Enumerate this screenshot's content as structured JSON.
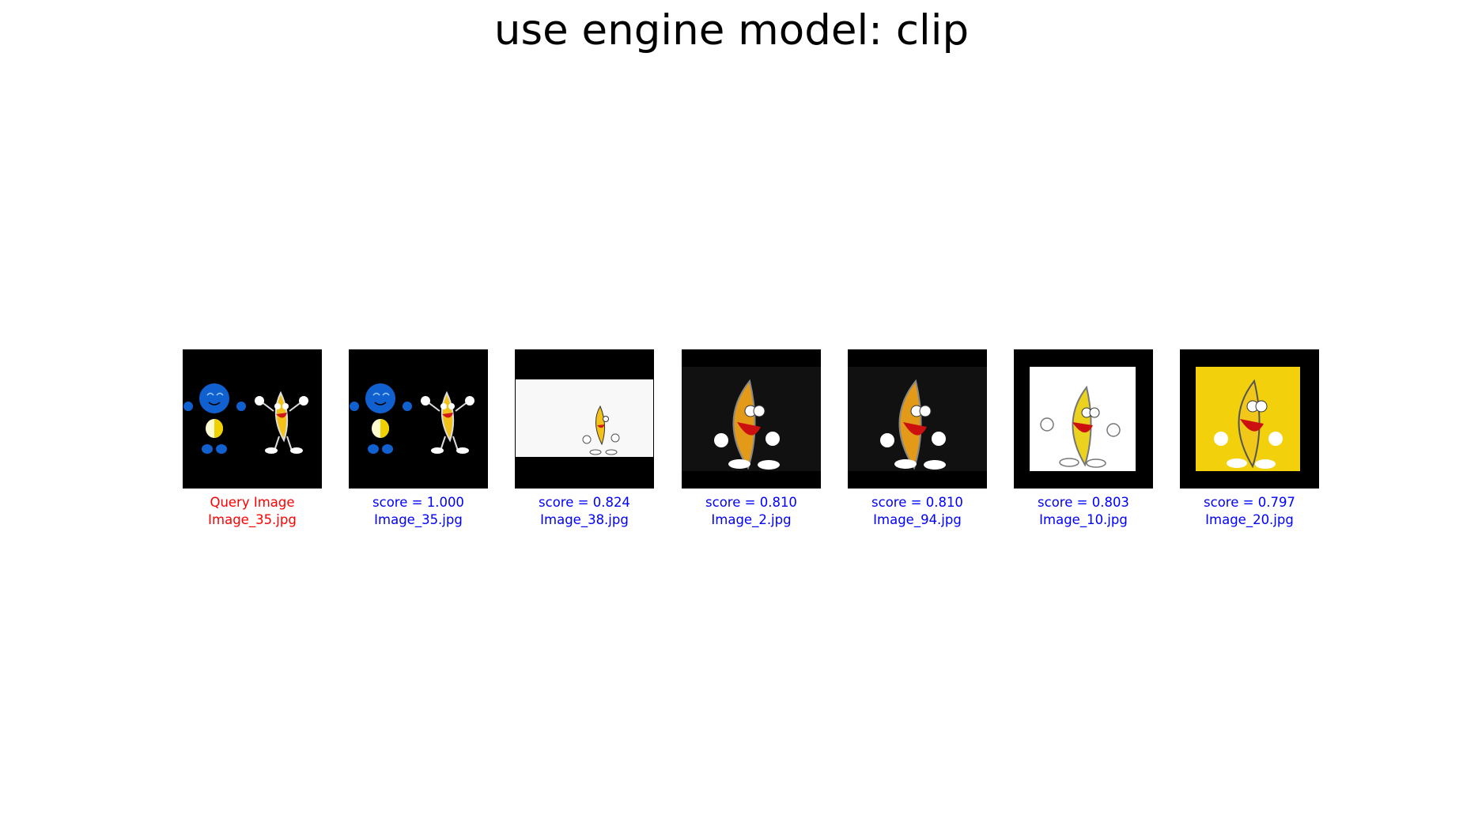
{
  "title": "use engine model: clip",
  "colors": {
    "query_caption": "#ff0000",
    "result_caption": "#0000ff"
  },
  "query": {
    "label": "Query Image",
    "file": "Image_35.jpg",
    "thumbnail": "blue-smiley-and-banana-dancing-icon"
  },
  "results": [
    {
      "score": "score = 1.000",
      "file": "Image_35.jpg",
      "thumbnail": "blue-smiley-and-banana-dancing-icon"
    },
    {
      "score": "score = 0.824",
      "file": "Image_38.jpg",
      "thumbnail": "small-dancing-banana-white-background-icon"
    },
    {
      "score": "score = 0.810",
      "file": "Image_2.jpg",
      "thumbnail": "dancing-banana-dark-background-icon"
    },
    {
      "score": "score = 0.810",
      "file": "Image_94.jpg",
      "thumbnail": "dancing-banana-dark-background-icon"
    },
    {
      "score": "score = 0.803",
      "file": "Image_10.jpg",
      "thumbnail": "dancing-banana-white-background-icon"
    },
    {
      "score": "score = 0.797",
      "file": "Image_20.jpg",
      "thumbnail": "dancing-banana-yellow-background-icon"
    }
  ]
}
